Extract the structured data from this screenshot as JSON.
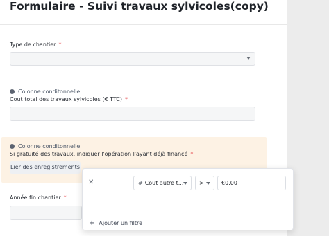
{
  "form": {
    "title": "Formulaire - Suivi travaux sylvicoles(copy)",
    "required_mark": "*",
    "fields": [
      {
        "label": "Type de chantier",
        "required": true,
        "type": "select",
        "value": ""
      },
      {
        "info_label": "Colonne conditonnelle",
        "label": "Cout total des travaux sylvicoles (€ TTC)",
        "required": true,
        "type": "text",
        "value": ""
      },
      {
        "info_label": "Colonne conditonnelle",
        "label": "Si gratuité des travaux, indiquer l'opération l'ayant déjà financé",
        "required": true,
        "type": "link",
        "button_label": "Lier des enregistrements"
      },
      {
        "label": "Année fin chantier",
        "required": true,
        "type": "text",
        "value": ""
      }
    ]
  },
  "filter_popup": {
    "field_label": "Cout autre t...",
    "field_icon": "hash-icon",
    "operator": ">",
    "value": "€0.00",
    "add_filter_label": "Ajouter un filtre"
  },
  "colors": {
    "highlight": "#fdf2e4",
    "required": "#e5484d",
    "sidebar": "#ececec"
  }
}
